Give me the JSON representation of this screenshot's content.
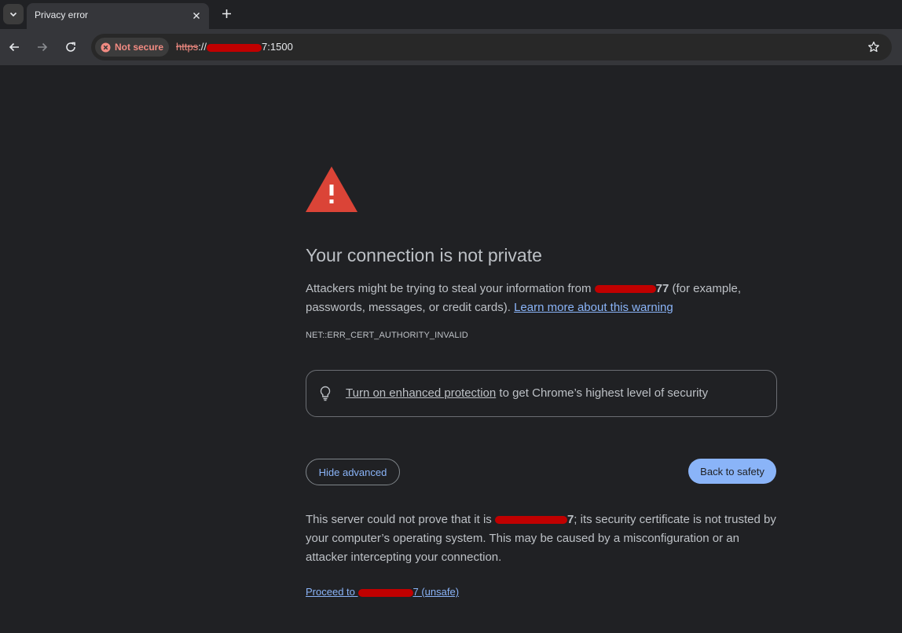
{
  "tabs": [
    {
      "title": "Privacy error",
      "active": true
    }
  ],
  "toolbar": {
    "security_chip": "Not secure",
    "url_scheme": "https",
    "url_sep": "://",
    "url_visible_suffix": "7:1500"
  },
  "page": {
    "heading": "Your connection is not private",
    "para1_a": "Attackers might be trying to steal your information from ",
    "para1_host_suffix": "77",
    "para1_b": " (for example, passwords, messages, or credit cards). ",
    "learn_more_link": "Learn more about this warning",
    "error_code": "NET::ERR_CERT_AUTHORITY_INVALID",
    "promo_link": "Turn on enhanced protection",
    "promo_rest": " to get Chrome’s highest level of security",
    "hide_advanced": "Hide advanced",
    "back_to_safety": "Back to safety",
    "para2_a": "This server could not prove that it is ",
    "para2_host_suffix": "7",
    "para2_b": "; its security certificate is not trusted by your computer’s operating system. This may be caused by a misconfiguration or an attacker intercepting your connection.",
    "proceed_prefix": "Proceed to ",
    "proceed_suffix": "7 (unsafe)"
  },
  "colors": {
    "background": "#202124",
    "toolbar": "#35363a",
    "link": "#8ab4f8",
    "warning_red": "#db4437",
    "insecure_red": "#f28b82",
    "redaction": "#c00000"
  },
  "icons": [
    "tab-search-icon",
    "close-icon",
    "plus-icon",
    "back-icon",
    "forward-icon",
    "reload-icon",
    "warning-icon",
    "star-icon",
    "warning-triangle-icon",
    "lightbulb-icon"
  ]
}
